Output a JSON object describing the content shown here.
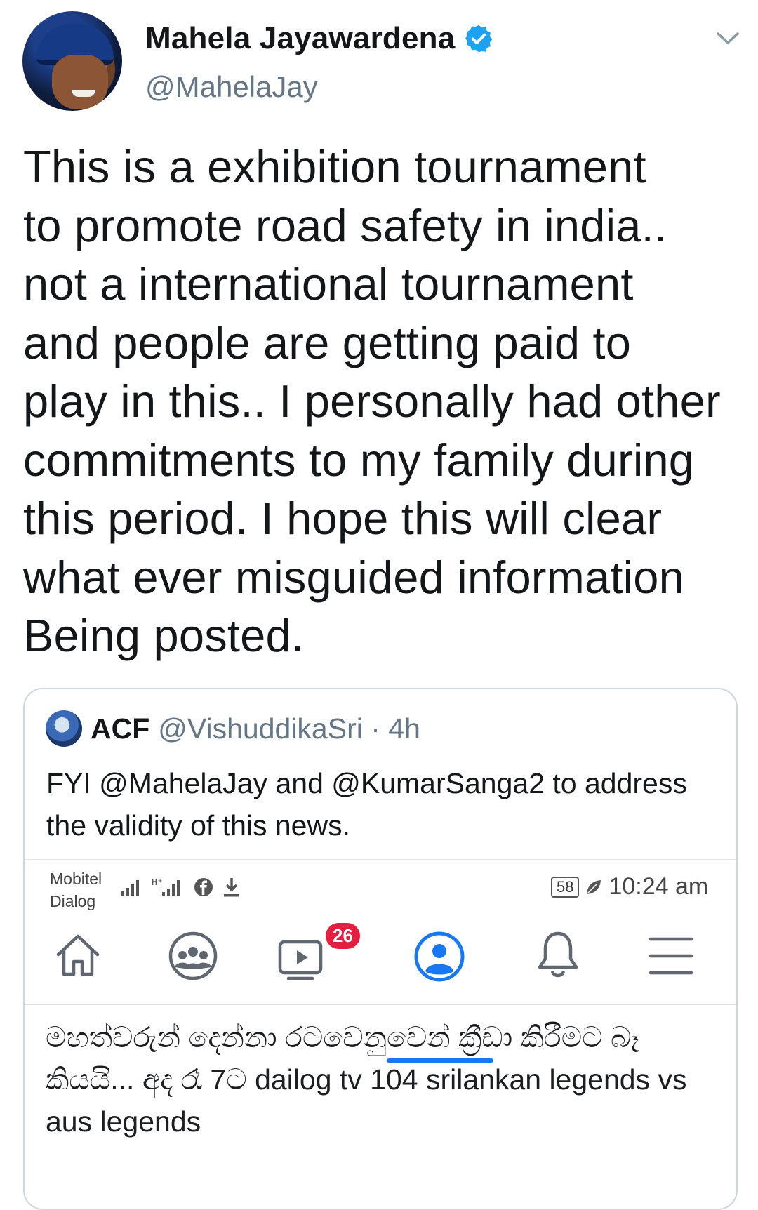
{
  "tweet": {
    "author_name": "Mahela Jayawardena",
    "author_handle": "@MahelaJay",
    "text": "This is a exhibition tournament\nto promote road safety in india..\nnot a international tournament\nand people are getting paid to\nplay in this.. I personally had other\ncommitments to my family during\nthis period. I hope this will clear\nwhat ever misguided information\nBeing posted."
  },
  "quoted": {
    "name": "ACF",
    "handle": "@VishuddikaSri · 4h",
    "text": "FYI @MahelaJay and @KumarSanga2 to address the validity of this news."
  },
  "screenshot": {
    "carrier1": "Mobitel",
    "carrier2": "Dialog",
    "battery": "58",
    "time": "10:24 am",
    "video_badge": "26",
    "post_text": "මහත්වරුන් දෙන්නා රටවෙනුවෙන් ක්‍රීඩා කිරීමට බෑ කියයි... අද රෑ 7ට dailog tv 104 srilankan legends vs aus legends"
  },
  "colors": {
    "verified": "#1da1f2",
    "fb_blue": "#1877f2",
    "badge_red": "#e41e3f"
  },
  "icons": [
    "verified-icon",
    "chevron-down-icon",
    "home-icon",
    "groups-icon",
    "watch-icon",
    "profile-icon",
    "bell-icon",
    "menu-icon",
    "facebook-icon",
    "download-icon"
  ]
}
